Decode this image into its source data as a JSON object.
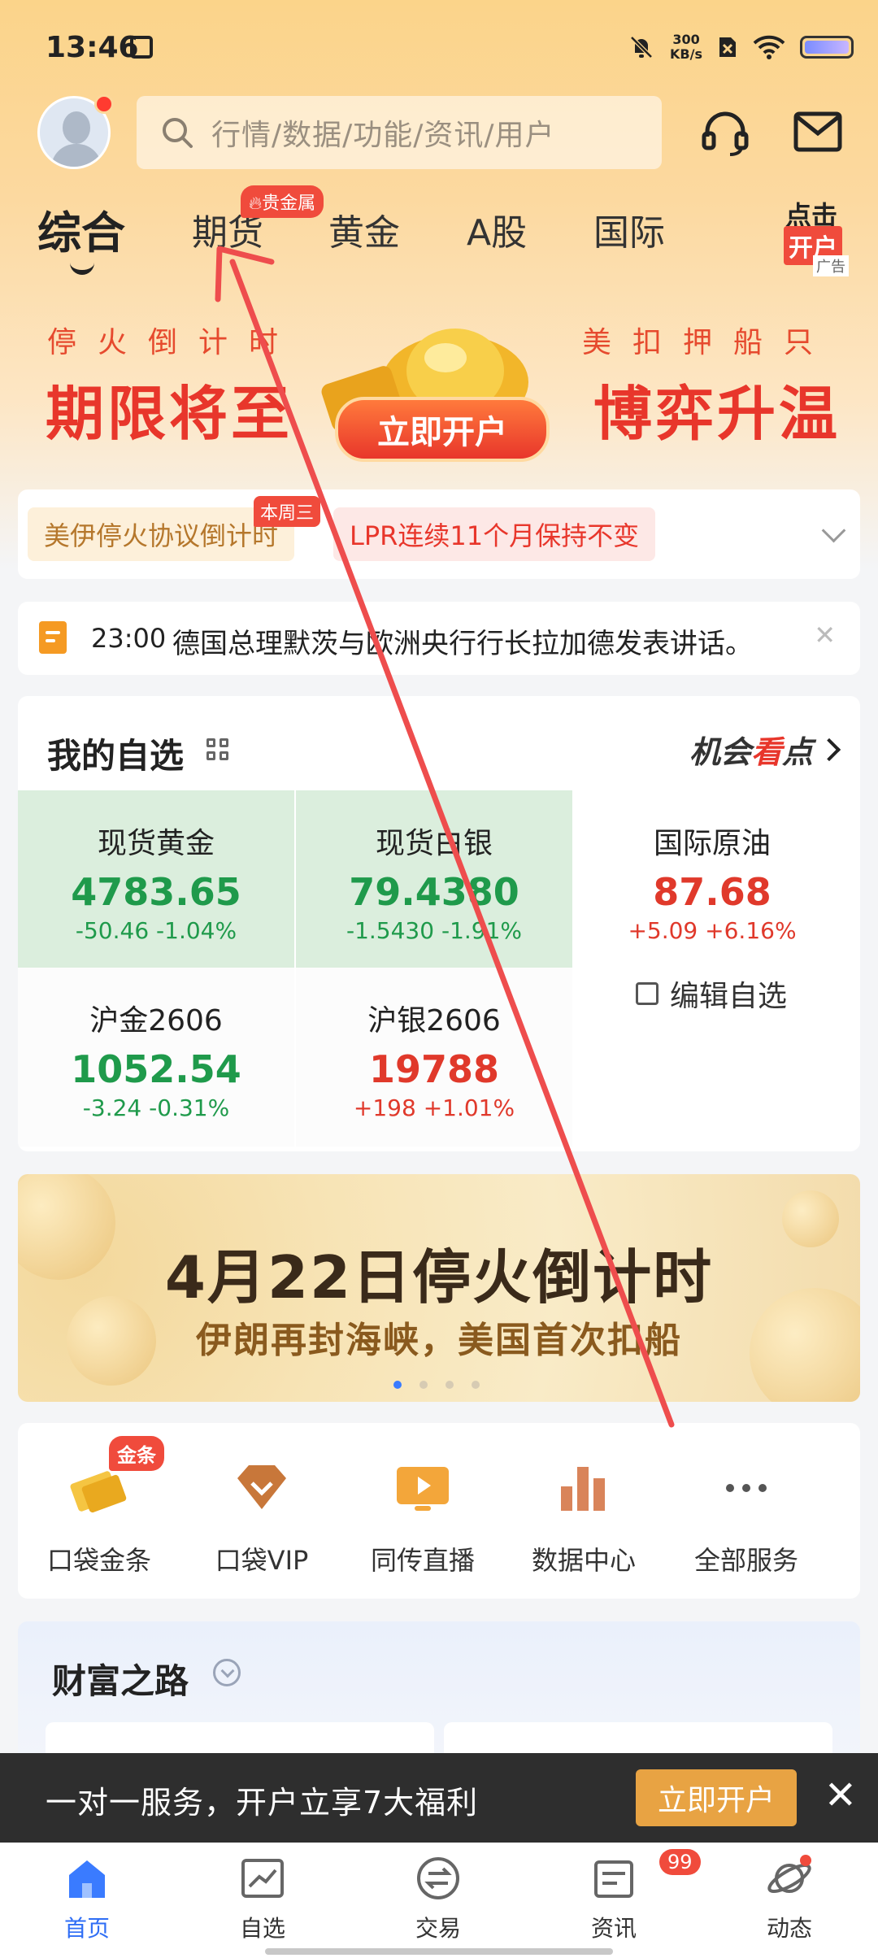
{
  "status_bar": {
    "time": "13:46",
    "net_speed_value": "300",
    "net_speed_unit": "KB/s"
  },
  "header": {
    "search_placeholder": "行情/数据/功能/资讯/用户"
  },
  "tabs": {
    "items": [
      "综合",
      "期货",
      "黄金",
      "A股",
      "国际"
    ],
    "active": "综合",
    "futures_badge": "贵金属",
    "ad_corner_line1": "点击",
    "ad_corner_line2": "开户",
    "ad_label": "广告"
  },
  "banner1": {
    "left_small": "停火倒计时",
    "left_big": "期限将至",
    "right_small": "美扣押船只",
    "right_big": "博弈升温",
    "button": "立即开户"
  },
  "hot_tags": {
    "tag1": "美伊停火协议倒计时",
    "tag1_badge": "本周三",
    "tag2": "LPR连续11个月保持不变"
  },
  "news": {
    "time": "23:00",
    "text": "德国总理默茨与欧洲央行行长拉加德发表讲话。"
  },
  "watchlist": {
    "title": "我的自选",
    "opportunity_prefix": "机会",
    "opportunity_mark": "看",
    "opportunity_suffix": "点",
    "items": [
      {
        "name": "现货黄金",
        "price": "4783.65",
        "change": "-50.46  -1.04%"
      },
      {
        "name": "现货白银",
        "price": "79.4380",
        "change": "-1.5430  -1.91%"
      },
      {
        "name": "国际原油",
        "price": "87.68",
        "change": "+5.09  +6.16%"
      },
      {
        "name": "沪金2606",
        "price": "1052.54",
        "change": "-3.24  -0.31%"
      },
      {
        "name": "沪银2606",
        "price": "19788",
        "change": "+198  +1.01%"
      }
    ],
    "edit_label": "编辑自选",
    "colors": {
      "down": "#1f9a4b",
      "up": "#e0392b"
    }
  },
  "banner2": {
    "title": "4月22日停火倒计时",
    "subtitle": "伊朗再封海峡，美国首次扣船",
    "page": 1,
    "pages": 4
  },
  "services": {
    "items": [
      {
        "label": "口袋金条",
        "icon": "gold-bar-icon"
      },
      {
        "label": "口袋VIP",
        "icon": "diamond-icon"
      },
      {
        "label": "同传直播",
        "icon": "live-play-icon"
      },
      {
        "label": "数据中心",
        "icon": "bar-chart-icon"
      },
      {
        "label": "全部服务",
        "icon": "more-icon"
      }
    ],
    "gold_badge": "金条"
  },
  "wealth": {
    "title": "财富之路"
  },
  "promo": {
    "text": "一对一服务，开户立享7大福利",
    "button": "立即开户"
  },
  "bottom_nav": {
    "items": [
      "首页",
      "自选",
      "交易",
      "资讯",
      "动态"
    ],
    "active": "首页",
    "news_badge": "99"
  }
}
